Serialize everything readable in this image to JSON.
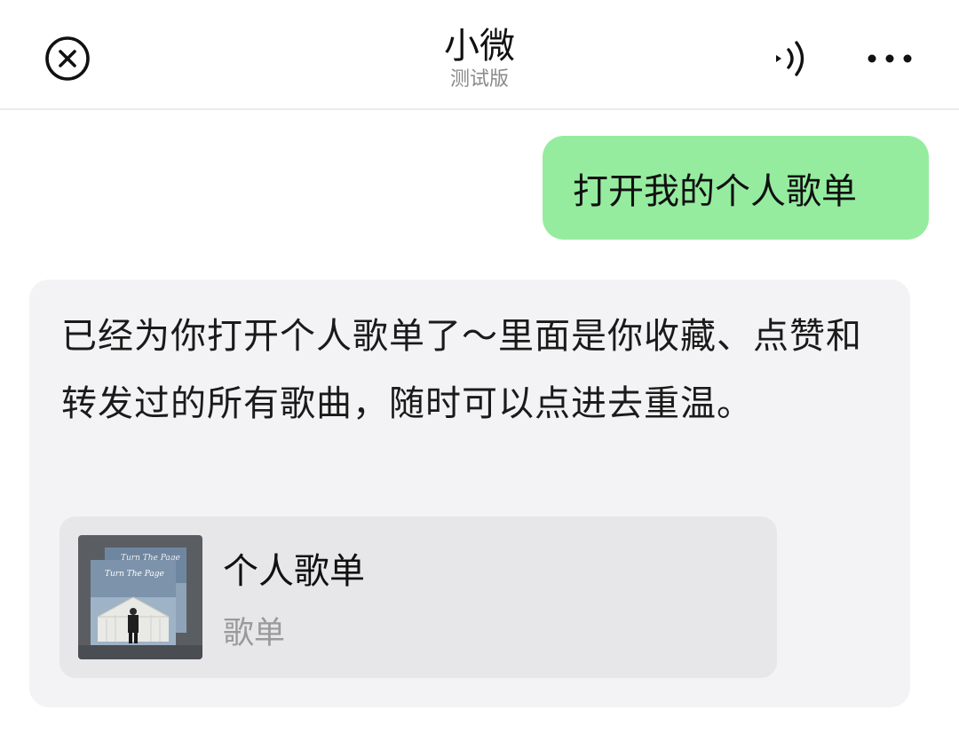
{
  "header": {
    "title": "小微",
    "subtitle": "测试版",
    "close_icon": "close-circle-icon",
    "audio_icon": "speaker-icon",
    "more_icon": "more-dots-icon"
  },
  "messages": {
    "user_text": "打开我的个人歌单",
    "bot_text": "已经为你打开个人歌单了～里面是你收藏、点赞和转发过的所有歌曲，随时可以点进去重温。"
  },
  "card": {
    "title": "个人歌单",
    "type": "歌单",
    "cover_text_front": "Turn The Page",
    "cover_text_back": "Turn The Page"
  },
  "colors": {
    "user_bubble": "#95ec9f",
    "bot_bubble": "#f3f3f5",
    "card_bg": "#e7e7ea"
  }
}
